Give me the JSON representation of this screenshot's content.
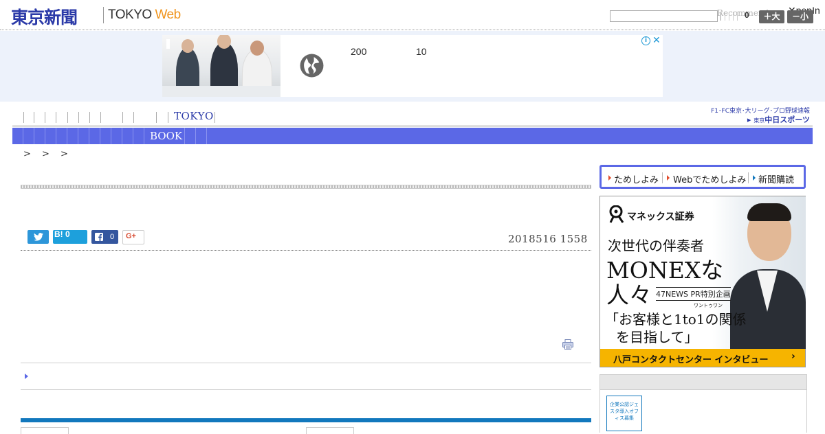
{
  "header": {
    "logo_jp": "東京新聞",
    "logo_en_tokyo": "TOKYO ",
    "logo_en_web": "Web",
    "search_placeholder": "",
    "recommend_label": "Recommend",
    "popin_label": "popIn",
    "text_count": "0",
    "size_large_label": "＋大",
    "size_small_label": "－小"
  },
  "ad_banner": {
    "number_1": "200",
    "number_2": "10",
    "info_icon": "ⓘ",
    "close_icon": "✕"
  },
  "nav": {
    "tokyo_label": "TOKYO",
    "book_label": "BOOK",
    "chunichi_line1": "F1･FC東京･大リーグ･プロ野球速報",
    "chunichi_small": "東京",
    "chunichi_main": "中日スポーツ"
  },
  "breadcrumb": {
    "text": "> > >"
  },
  "article": {
    "date": "2018516 1558",
    "share": {
      "hatena_label": "B! 0",
      "facebook_count": "0",
      "google_label": "G+"
    }
  },
  "sidebar": {
    "subscription": {
      "item_1": "ためしよみ",
      "item_2": "Webでためしよみ",
      "item_3": "新聞購読"
    },
    "monex_ad": {
      "logo": "マネックス証券",
      "line1": "次世代の伴奏者",
      "line2": "MONEXな",
      "line3": "人々",
      "pr_label": "47NEWS PR特別企画",
      "ruby": "ワントゥワン",
      "line4": "「お客様と1to1の関係",
      "line5": "を目指して」",
      "footer": "八戸コンタクトセンター インタビュー",
      "footer_chevron": "›"
    },
    "badge_text": "企業公認ジェスタ導入オフィス募集"
  },
  "colors": {
    "brand_blue": "#2b3aa8",
    "nav_blue": "#5b68e6",
    "web_orange": "#f0941d",
    "rule_blue": "#1278bd",
    "monex_yellow": "#f6b400"
  }
}
